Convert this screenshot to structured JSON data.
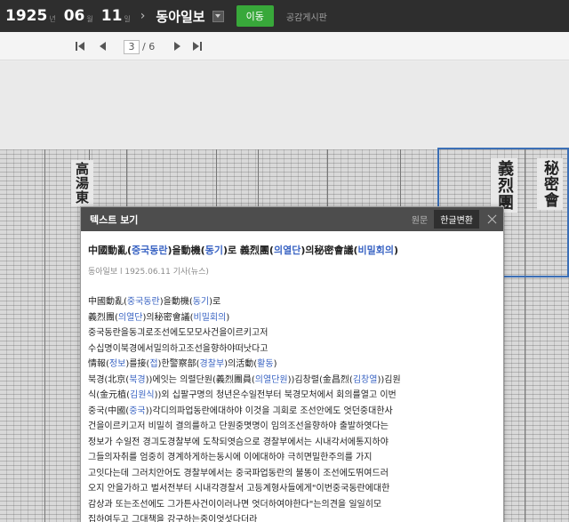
{
  "topbar": {
    "year": "1925",
    "year_unit": "년",
    "month": "06",
    "month_unit": "월",
    "day": "11",
    "day_unit": "일",
    "newspaper": "동아일보",
    "move_button": "이동",
    "board_link": "공감게시판"
  },
  "pager": {
    "current_page": "3",
    "total": "/ 6"
  },
  "popup": {
    "title": "텍스트 보기",
    "tab_original": "원문",
    "tab_hangul": "한글변환",
    "article_title": [
      {
        "t": "中國動亂("
      },
      {
        "t": "중국동란",
        "h": true
      },
      {
        "t": ")을動機("
      },
      {
        "t": "동기",
        "h": true
      },
      {
        "t": ")로 義烈團("
      },
      {
        "t": "의열단",
        "h": true
      },
      {
        "t": ")의秘密會議("
      },
      {
        "t": "비밀회의",
        "h": true
      },
      {
        "t": ")"
      }
    ],
    "meta": "동아일보 l 1925.06.11 기사(뉴스)",
    "lines": [
      [
        {
          "t": "中國動亂("
        },
        {
          "t": "중국동란",
          "h": true
        },
        {
          "t": ")을動機("
        },
        {
          "t": "동기",
          "h": true
        },
        {
          "t": ")로"
        }
      ],
      [
        {
          "t": "義烈團("
        },
        {
          "t": "의열단",
          "h": true
        },
        {
          "t": ")의秘密會議("
        },
        {
          "t": "비밀회의",
          "h": true
        },
        {
          "t": ")"
        }
      ],
      [
        {
          "t": "중국동란을동긔로조선에도모모사건을이르키고저"
        }
      ],
      [
        {
          "t": "수십명이북경에서밀의하고조선을향하야떠낫다고"
        }
      ],
      [
        {
          "t": "情報("
        },
        {
          "t": "정보",
          "h": true
        },
        {
          "t": ")를接("
        },
        {
          "t": "접",
          "h": true
        },
        {
          "t": ")한警察部("
        },
        {
          "t": "경찰부",
          "h": true
        },
        {
          "t": ")의活動("
        },
        {
          "t": "활동",
          "h": true
        },
        {
          "t": ")"
        }
      ],
      [
        {
          "t": "북경(北京("
        },
        {
          "t": "북경",
          "h": true
        },
        {
          "t": "))에잇는 의렬단원(義烈團員("
        },
        {
          "t": "의열단원",
          "h": true
        },
        {
          "t": "))김창렬(金昌烈("
        },
        {
          "t": "김창열",
          "h": true
        },
        {
          "t": "))김원"
        }
      ],
      [
        {
          "t": "식(金元植("
        },
        {
          "t": "김원식",
          "h": true
        },
        {
          "t": "))외 십팔구명의 청년은수일전부터 북경모처에서 회의를열고 이번"
        }
      ],
      [
        {
          "t": "중국(中國("
        },
        {
          "t": "중국",
          "h": true
        },
        {
          "t": "))각디의파업동란에대하야 이것을 긔회로 조선안에도 엇던중대한사"
        }
      ],
      [
        {
          "t": "건을이르키고저 비밀히 결의를하고 단원중몃명이 임의조선을향하야 출발하엿다는"
        }
      ],
      [
        {
          "t": "정보가 수일전 경긔도경찰부에 도착되엿슴으로 경찰부에서는 시내각서에통지하야"
        }
      ],
      [
        {
          "t": "그들의자취를 엄중히 경계하게하는동시에 이에대하야 극히면밀한주의를 가지"
        }
      ],
      [
        {
          "t": "고잇다는데 그러치안어도 경찰부에서는 중국파업동란의 불똥이 조선에도뛰여드러"
        }
      ],
      [
        {
          "t": "오지 안을가하고 벌서전부터 시내각경찰서 고등계형사들에게\"이번중국동란에대한"
        }
      ],
      [
        {
          "t": "감상과 또는조선에도 그가튼사건이이러나면 엇더하여야한다\"는의견을 일일히모"
        }
      ],
      [
        {
          "t": "집하여두고 그대책을 강구하는중이엇섯다더라"
        }
      ]
    ]
  }
}
